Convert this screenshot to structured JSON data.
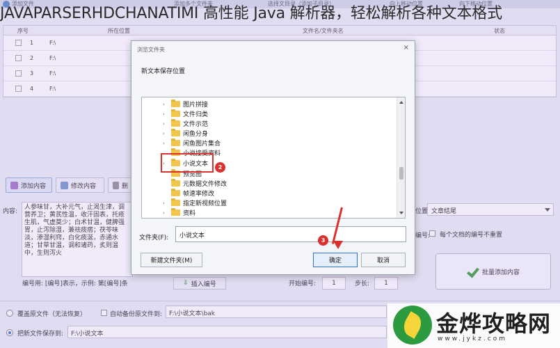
{
  "caption": "JAVAPARSERHDCHANATIMI 高性能 Java 解析器，轻松解析各种文本格式",
  "toolbar": {
    "add_files": "添加文件",
    "add_multiple": "添加多个文件夹",
    "select_dir": "选择文目录（添加子目录）",
    "move_up": "向上移动位置",
    "move_down": "向下移动位置"
  },
  "grid": {
    "columns": [
      "序号",
      "所在位置",
      "文件名/文件夹名",
      "状态"
    ],
    "rows": [
      {
        "num": "1",
        "path": "F:\\"
      },
      {
        "num": "2",
        "path": "F:\\"
      },
      {
        "num": "3",
        "path": "F:\\"
      },
      {
        "num": "4",
        "path": "F:\\"
      }
    ]
  },
  "mid_buttons": {
    "add_content": "添加内容",
    "edit_content": "修改内容",
    "third": "删"
  },
  "content": {
    "label": "内容:",
    "text": "人参味甘，大补元气，止渴生津，调营养卫；黄芪性温，收汗固表，托疮生肌，气虚莫少；白术甘温，健脾强胃，止泻除湿，兼祛痰痞；茯苓味淡，渗湿利窍，白化痰涎，赤通水道；甘草甘温，调和诸药，炙则温中，生则泻火"
  },
  "right_panel": {
    "position_label": "位置",
    "position_value": "文章结尾",
    "numbering_label": "编号:",
    "no_repeat": "每个文档的编号不重置",
    "batch_add": "批量添加内容"
  },
  "numbering": {
    "hint": "编号用: [编号]表示，示例: 第[编号]条",
    "insert_btn": "插入编号",
    "start_label": "开始编号:",
    "start_value": "1",
    "step_label": "步长:",
    "step_value": "1"
  },
  "bottom": {
    "overwrite": "覆盖原文件（无法恢复）",
    "auto_backup": "自动备份原文件到:",
    "backup_path": "F:\\小说文本\\bak",
    "save_new": "把新文件保存到:",
    "save_path": "F:\\小说文本"
  },
  "dialog": {
    "title": "浏览文件夹",
    "close": "×",
    "subtitle": "新文本保存位置",
    "folders": [
      "图片拼接",
      "文件归类",
      "文件示范",
      "闲鱼分身",
      "闲鱼图片集合",
      "小说接受资料",
      "小说文本",
      "预览图",
      "元数据文件修改",
      "帧速率修改",
      "指定新视频位置",
      "资料"
    ],
    "selected_folder": "小说文本",
    "folder_label": "文件夹(F):",
    "folder_value": "小说文本",
    "new_folder_btn": "新建文件夹(M)",
    "ok_btn": "确定",
    "cancel_btn": "取消",
    "badge_2": "2",
    "badge_3": "3"
  },
  "watermark": {
    "name": "金烨攻略网",
    "url": "www.jykz.com"
  },
  "colors": {
    "annotation_red": "#d9322e",
    "accent_blue": "#2f6fd6",
    "folder_yellow": "#f2c64c"
  }
}
